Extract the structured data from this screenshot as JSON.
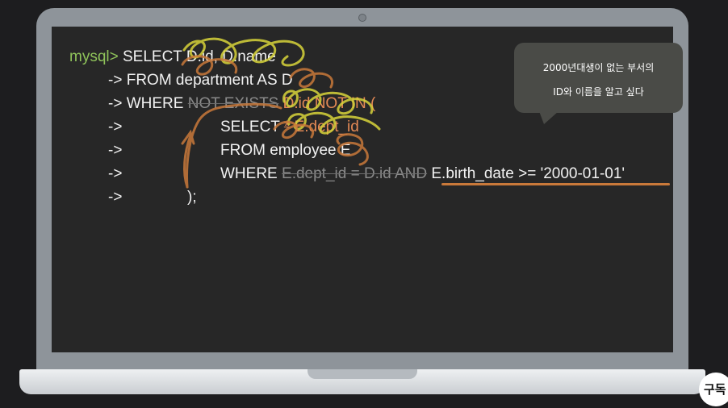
{
  "sql": {
    "prompt": "mysql>",
    "continuation": "->",
    "line1": "SELECT D.id, D.name",
    "line2": "FROM department AS D",
    "line3_where": "WHERE",
    "line3_not_exists": "NOT EXISTS",
    "line3_not_in": "D.id NOT IN (",
    "line4_select": "SELECT",
    "line4_struck_star": "*",
    "line4_dept_id": "E.dept_id",
    "line5": "FROM employee E",
    "line6_where": "WHERE",
    "line6_struck": "E.dept_id = D.id AND",
    "line6_condition": "E.birth_date >= '2000-01-01'",
    "line7": ");"
  },
  "callout": {
    "line1": "2000년대생이 없는 부서의",
    "line2": "ID와 이름을 알고 싶다"
  },
  "badge": {
    "label": "구독"
  },
  "colors": {
    "prompt": "#8fc35a",
    "annotation_orange": "#c9793a",
    "highlight_yellow": "#d8d43a",
    "screen_bg": "#272727"
  }
}
